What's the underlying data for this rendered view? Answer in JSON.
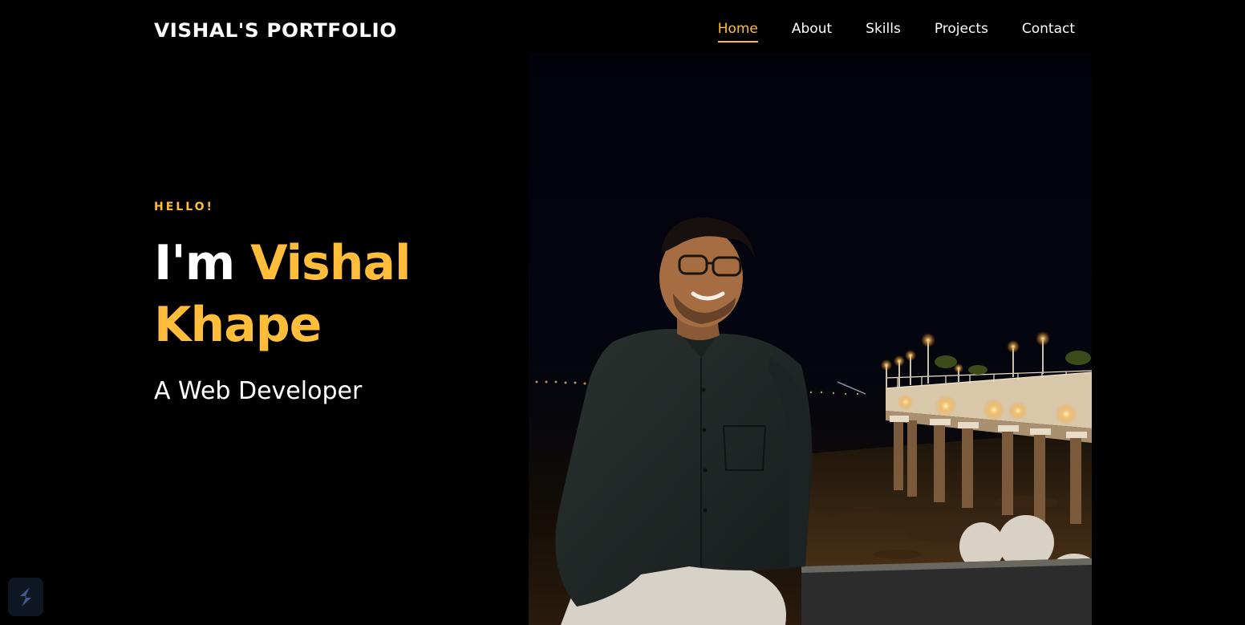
{
  "header": {
    "brand": "VISHAL'S  PORTFOLIO",
    "nav": [
      {
        "label": "Home",
        "active": true
      },
      {
        "label": "About",
        "active": false
      },
      {
        "label": "Skills",
        "active": false
      },
      {
        "label": "Projects",
        "active": false
      },
      {
        "label": "Contact",
        "active": false
      }
    ]
  },
  "hero": {
    "greeting": "HELLO!",
    "intro": "I'm",
    "first_name": "Vishal",
    "last_name": "Khape",
    "subtitle": "A Web Developer"
  },
  "colors": {
    "accent": "#ffbd39",
    "background": "#000000",
    "text": "#ffffff"
  },
  "icons": {
    "floating_badge": "s-logo-icon"
  }
}
